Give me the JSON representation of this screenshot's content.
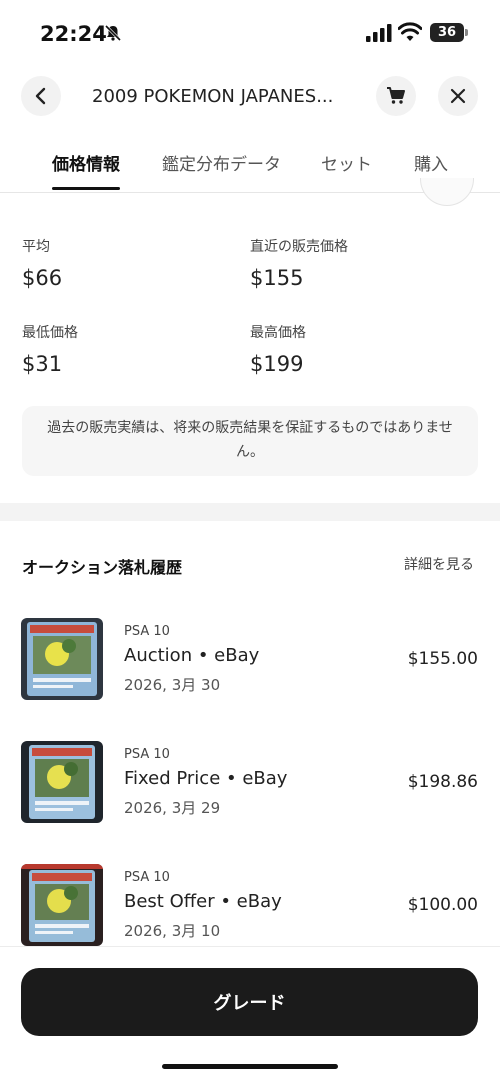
{
  "status_bar": {
    "time": "22:24",
    "battery": "36"
  },
  "header": {
    "title": "2009 POKEMON JAPANES..."
  },
  "tabs": [
    {
      "label": "価格情報"
    },
    {
      "label": "鑑定分布データ"
    },
    {
      "label": "セット"
    },
    {
      "label": "購入"
    }
  ],
  "stats": {
    "average_label": "平均",
    "average_value": "$66",
    "recent_label": "直近の販売価格",
    "recent_value": "$155",
    "min_label": "最低価格",
    "min_value": "$31",
    "max_label": "最高価格",
    "max_value": "$199"
  },
  "notice": "過去の販売実績は、将来の販売結果を保証するものではありません。",
  "auction_section": {
    "title": "オークション落札履歴",
    "see_more": "詳細を見る"
  },
  "sales": [
    {
      "grade": "PSA 10",
      "title": "Auction • eBay",
      "date": "2026, 3月 30",
      "price": "$155.00"
    },
    {
      "grade": "PSA 10",
      "title": "Fixed Price • eBay",
      "date": "2026, 3月 29",
      "price": "$198.86"
    },
    {
      "grade": "PSA 10",
      "title": "Best Offer • eBay",
      "date": "2026, 3月 10",
      "price": "$100.00"
    }
  ],
  "cta": {
    "label": "グレード"
  },
  "icons": {
    "bell": "bell-slash-icon",
    "signal": "cellular-signal-icon",
    "wifi": "wifi-icon",
    "back": "chevron-left-icon",
    "cart": "cart-icon",
    "close": "close-icon"
  }
}
